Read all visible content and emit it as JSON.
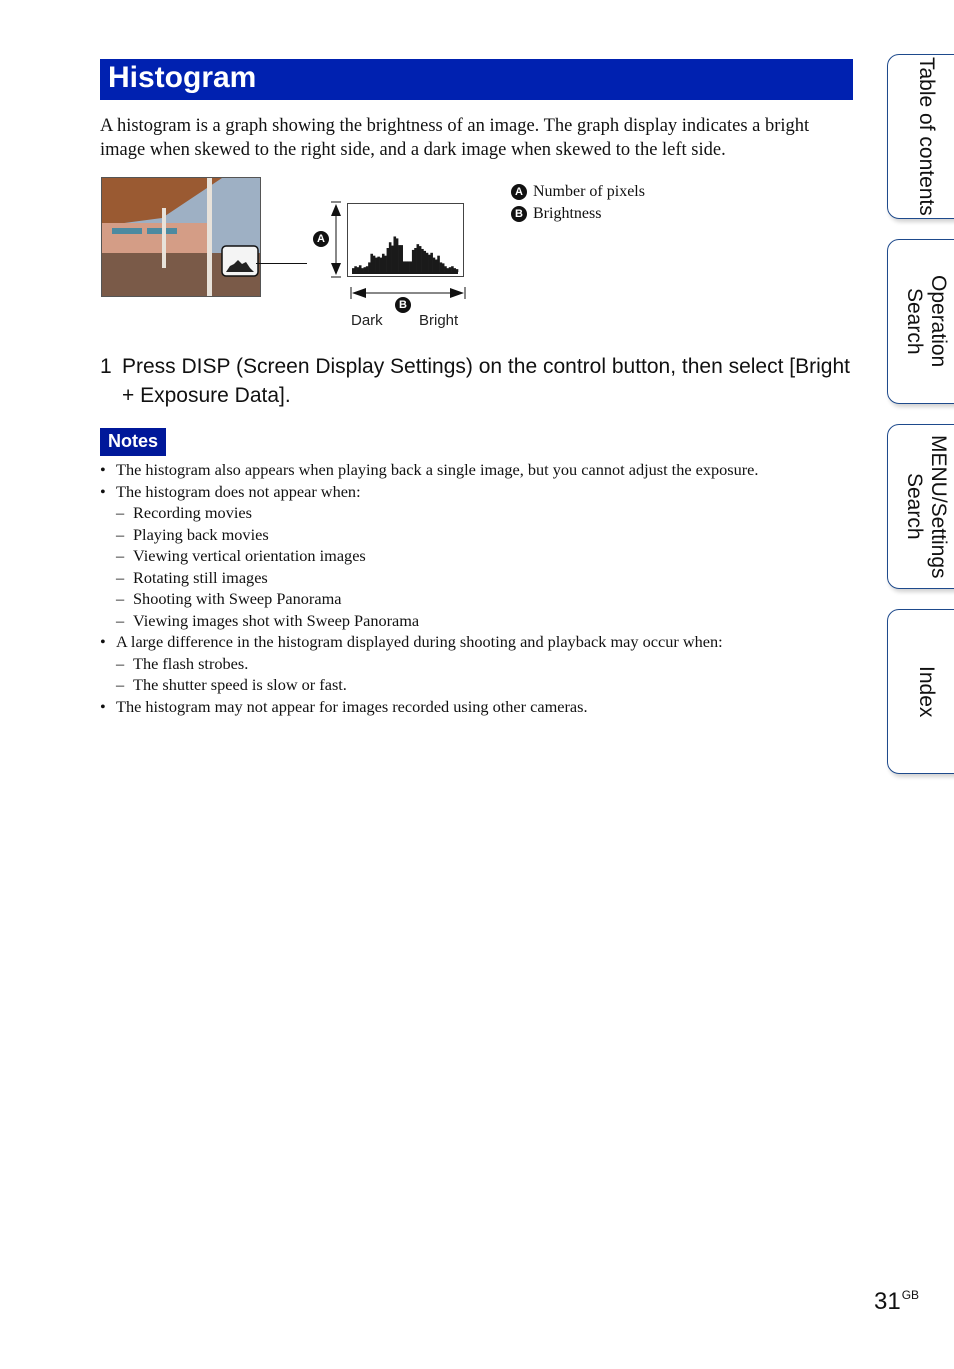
{
  "header": {
    "title": "Histogram"
  },
  "intro": "A histogram is a graph showing the brightness of an image. The graph display indicates a bright image when skewed to the right side, and a dark image when skewed to the left side.",
  "figure": {
    "photo_alt": "Terrace photo with histogram overlay",
    "callout_a": "A",
    "callout_b": "B",
    "dark_label": "Dark",
    "bright_label": "Bright",
    "histogram_levels": [
      0.08,
      0.12,
      0.1,
      0.14,
      0.08,
      0.1,
      0.12,
      0.2,
      0.38,
      0.34,
      0.3,
      0.32,
      0.3,
      0.38,
      0.34,
      0.5,
      0.62,
      0.55,
      0.74,
      0.7,
      0.56,
      0.56,
      0.22,
      0.22,
      0.22,
      0.22,
      0.46,
      0.5,
      0.58,
      0.54,
      0.48,
      0.44,
      0.4,
      0.36,
      0.4,
      0.3,
      0.26,
      0.34,
      0.2,
      0.18,
      0.12,
      0.08,
      0.1,
      0.12,
      0.08,
      0.06
    ],
    "legend": [
      {
        "badge": "A",
        "label": "Number of pixels"
      },
      {
        "badge": "B",
        "label": "Brightness"
      }
    ]
  },
  "step": {
    "number": "1",
    "text": "Press DISP (Screen Display Settings) on the control button, then select [Bright + Exposure Data]."
  },
  "notes": {
    "heading": "Notes",
    "lines": [
      {
        "type": "bullet",
        "text": "The histogram also appears when playing back a single image, but you cannot adjust the exposure."
      },
      {
        "type": "bullet",
        "text": "The histogram does not appear when:"
      },
      {
        "type": "sub",
        "text": "Recording movies"
      },
      {
        "type": "sub",
        "text": "Playing back movies"
      },
      {
        "type": "sub",
        "text": "Viewing vertical orientation images"
      },
      {
        "type": "sub",
        "text": "Rotating still images"
      },
      {
        "type": "sub",
        "text": "Shooting with Sweep Panorama"
      },
      {
        "type": "sub",
        "text": "Viewing images shot with Sweep Panorama"
      },
      {
        "type": "bullet",
        "text": "A large difference in the histogram displayed during shooting and playback may occur when:"
      },
      {
        "type": "sub",
        "text": "The flash strobes."
      },
      {
        "type": "sub",
        "text": "The shutter speed is slow or fast."
      },
      {
        "type": "bullet",
        "text": "The histogram may not appear for images recorded using other cameras."
      }
    ]
  },
  "side_tabs": [
    {
      "label": "Table of contents"
    },
    {
      "label": "Operation Search"
    },
    {
      "label": "MENU/Settings Search"
    },
    {
      "label": "Index"
    }
  ],
  "page": {
    "number": "31",
    "suffix": "GB"
  },
  "colors": {
    "title_bar": "#0021b0",
    "notes_badge": "#00189a",
    "tab_border": "#1e4a8c"
  }
}
